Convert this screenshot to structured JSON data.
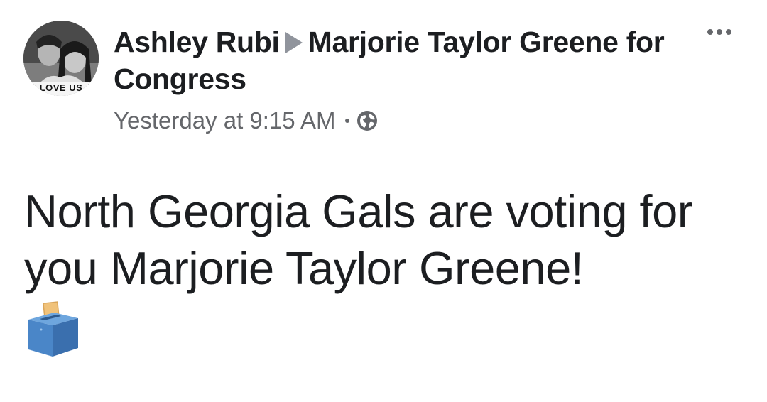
{
  "post": {
    "avatar_caption": "LOVE US",
    "author": "Ashley Rubi",
    "target": "Marjorie Taylor Greene for Congress",
    "timestamp": "Yesterday at 9:15 AM",
    "privacy_icon": "globe-icon",
    "more_icon": "more-options-icon",
    "body": "North Georgia Gals are voting for you Marjorie Taylor Greene!",
    "emoji": "ballot-box-icon"
  },
  "colors": {
    "name_text": "#1c1e21",
    "meta_text": "#65676b",
    "arrow": "#90949c",
    "ballot_blue": "#4a86c8",
    "ballot_paper": "#f0c27a"
  }
}
